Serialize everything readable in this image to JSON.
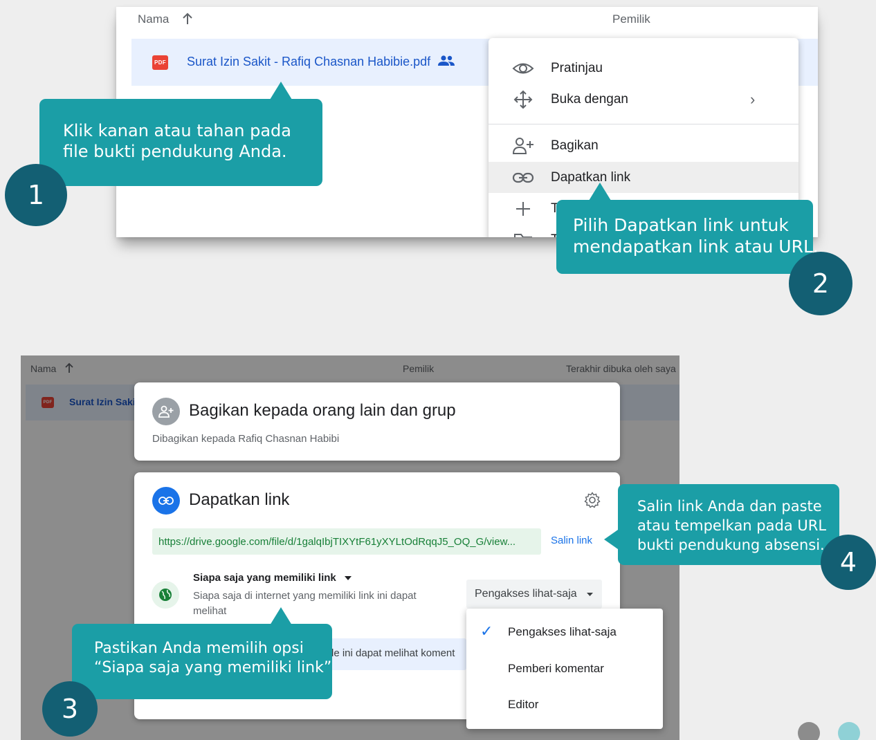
{
  "panel1": {
    "header": {
      "name_col": "Nama",
      "owner_col": "Pemilik"
    },
    "file": {
      "badge": "PDF",
      "name": "Surat Izin Sakit - Rafiq Chasnan Habibie.pdf"
    },
    "context_menu": {
      "items": [
        {
          "label": "Pratinjau",
          "icon": "eye-icon"
        },
        {
          "label": "Buka dengan",
          "icon": "move-icon",
          "chevron": "›"
        },
        {
          "label": "Bagikan",
          "icon": "add-person-icon"
        },
        {
          "label": "Dapatkan link",
          "icon": "link-icon"
        },
        {
          "label": "T",
          "icon": "plus-icon"
        },
        {
          "label": "T",
          "icon": "folder-icon"
        }
      ]
    }
  },
  "callouts": {
    "c1": {
      "line1": "Klik  kanan  atau  tahan  pada",
      "line2": "file bukti pendukung Anda.",
      "number": "1"
    },
    "c2": {
      "line1": "Pilih Dapatkan link untuk",
      "line2": "mendapatkan link atau URL.",
      "number": "2"
    },
    "c3": {
      "line1": "Pastikan Anda memilih opsi",
      "line2": "“Siapa saja yang memiliki link”",
      "number": "3"
    },
    "c4": {
      "line1": "Salin link Anda dan paste",
      "line2": "atau tempelkan pada URL",
      "line3": "bukti pendukung absensi.",
      "number": "4"
    }
  },
  "panel2": {
    "header": {
      "name_col": "Nama",
      "owner_col": "Pemilik",
      "last_opened_col": "Terakhir dibuka oleh saya"
    },
    "file": {
      "badge": "PDF",
      "name": "Surat Izin Sakit"
    },
    "share_card": {
      "title": "Bagikan kepada orang lain dan grup",
      "subtitle": "Dibagikan kepada Rafiq Chasnan Habibi"
    },
    "link_card": {
      "title": "Dapatkan link",
      "url": "https://drive.google.com/file/d/1galqIbjTIXYtF61yXYLtOdRqqJ5_OQ_G/view...",
      "copy_label": "Salin link",
      "access_title": "Siapa saja yang memiliki link",
      "access_desc_line1": "Siapa saja di internet yang memiliki link ini dapat",
      "access_desc_line2": "melihat",
      "role_button": "Pengakses lihat-saja",
      "partial_text": "le ini dapat melihat koment"
    },
    "role_menu": {
      "items": [
        "Pengakses lihat-saja",
        "Pemberi komentar",
        "Editor"
      ],
      "checked": "✓"
    }
  },
  "colors": {
    "callout": "#1b9ea6",
    "number_circle": "#135f73",
    "accent_blue": "#1a73e8",
    "dot_gray": "#8c8c8c",
    "dot_teal": "#8fd1d6"
  }
}
